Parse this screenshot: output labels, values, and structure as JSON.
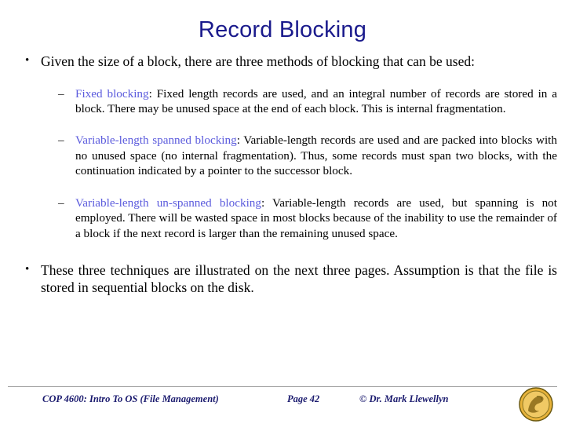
{
  "slide": {
    "title": "Record Blocking",
    "bullets": [
      {
        "level": 1,
        "marker": "•",
        "text": "Given the size of a block, there are three methods of blocking that can be used:"
      },
      {
        "level": 2,
        "marker": "–",
        "term": "Fixed blocking",
        "text": ": Fixed length records are used, and an integral number of records are stored in a block.  There may be unused space at the end of each block.  This is internal fragmentation."
      },
      {
        "level": 2,
        "marker": "–",
        "term": "Variable-length spanned blocking",
        "text": ": Variable-length records are used and are packed into blocks with no unused space (no internal fragmentation).  Thus, some records must span two blocks, with the continuation indicated by a pointer to the successor block."
      },
      {
        "level": 2,
        "marker": "–",
        "term": "Variable-length un-spanned blocking",
        "text": ":  Variable-length records are used, but spanning is not employed.   There will be wasted space in most blocks because of the inability to use the remainder of a block if the next record is larger than the remaining unused space."
      },
      {
        "level": 1,
        "marker": "•",
        "text": "These three techniques are illustrated on the next three pages.  Assumption is that the file is stored in sequential blocks on the disk."
      }
    ]
  },
  "footer": {
    "course": "COP 4600: Intro To OS  (File Management)",
    "page": "Page 42",
    "copyright": "© Dr. Mark Llewellyn"
  },
  "colors": {
    "title": "#1a1a8c",
    "term": "#5b5bdd",
    "footer": "#1a1a6e",
    "rule": "#9a9a9a"
  }
}
